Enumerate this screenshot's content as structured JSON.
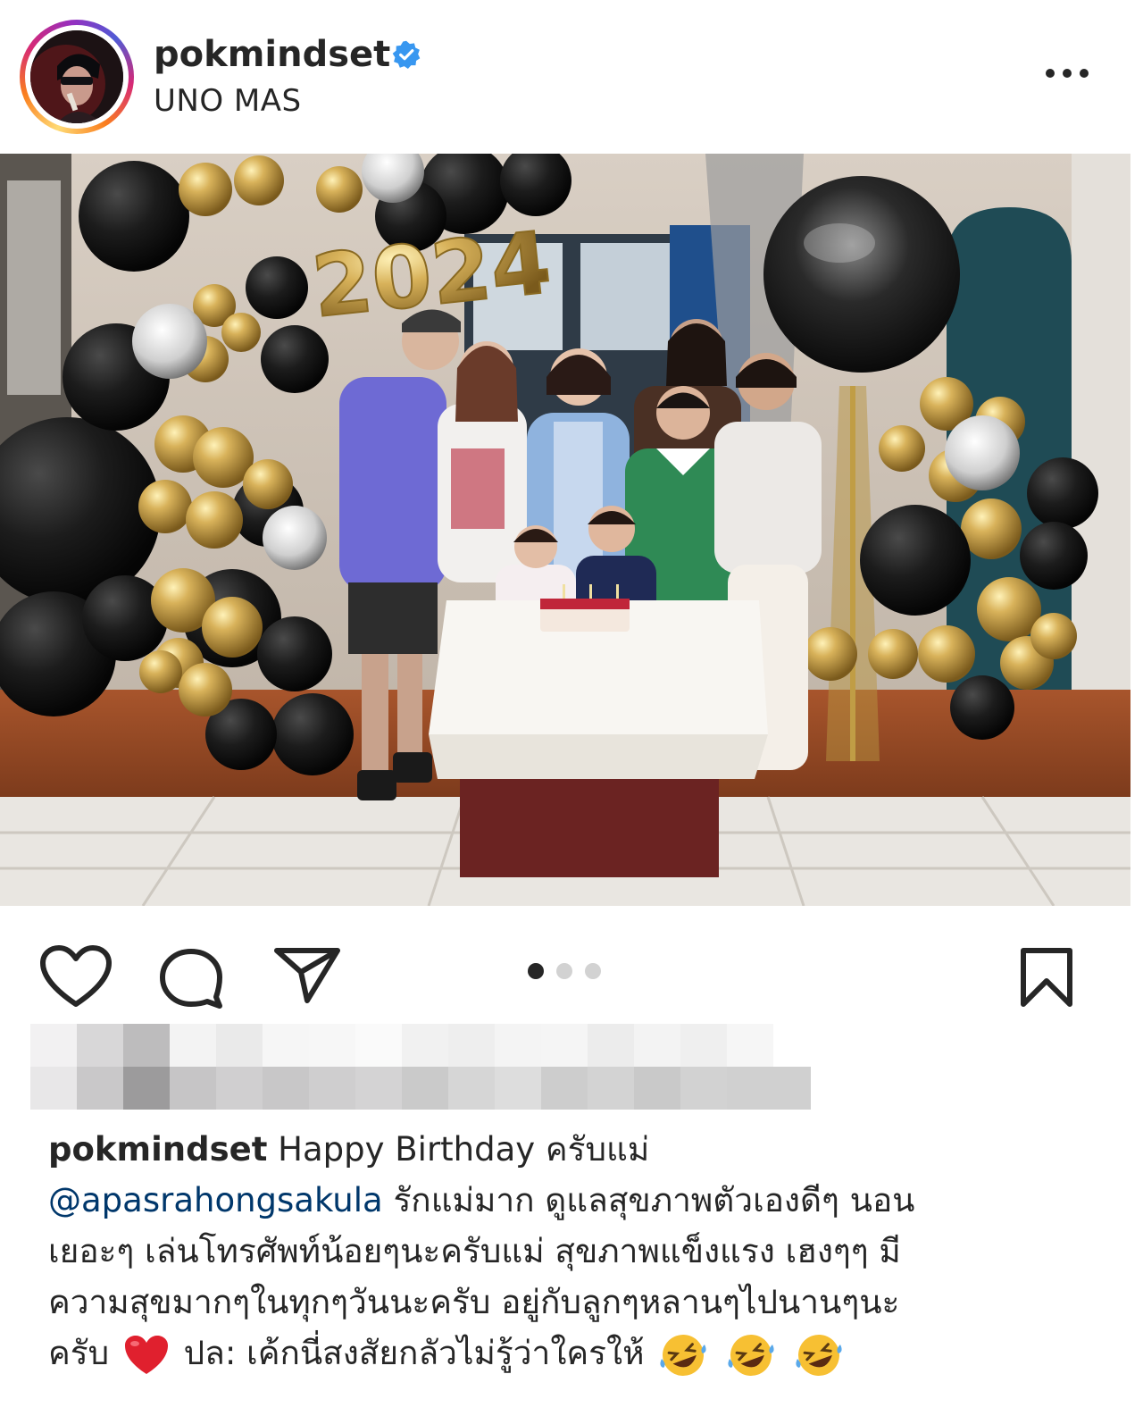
{
  "post": {
    "username": "pokmindset",
    "location": "UNO MAS",
    "verified": true,
    "photo_text": "2024",
    "carousel": {
      "count": 3,
      "active_index": 0
    }
  },
  "icons": {
    "avatar": "profile-avatar",
    "verified": "verified-badge-icon",
    "more": "more-options-icon",
    "like": "heart-icon",
    "comment": "comment-bubble-icon",
    "share": "paper-plane-icon",
    "save": "bookmark-icon"
  },
  "caption": {
    "username": "pokmindset",
    "line1": "Happy Birthday ครับแม่",
    "mention": "@apasrahongsakula",
    "line2_rest": "รักแม่มาก ดูแลสุขภาพตัวเองดีๆ นอน",
    "line3": "เยอะๆ เล่นโทรศัพท์น้อยๆนะครับแม่ สุขภาพแข็งแรง เฮงๆๆ มี",
    "line4": "ความสุขมากๆในทุกๆวันนะครับ อยู่กับลูกๆหลานๆไปนานๆนะ",
    "line5_a": "ครับ",
    "line5_b": "ปล: เค้กนี่สงสัยกลัวไม่รู้ว่าใครให้",
    "emoji_heart": "red-heart",
    "emoji_laugh": "rolling-on-floor-laughing"
  },
  "colors": {
    "verified": "#3897f0",
    "mention": "#00376b",
    "text": "#262626",
    "heart": "#e0202e"
  }
}
